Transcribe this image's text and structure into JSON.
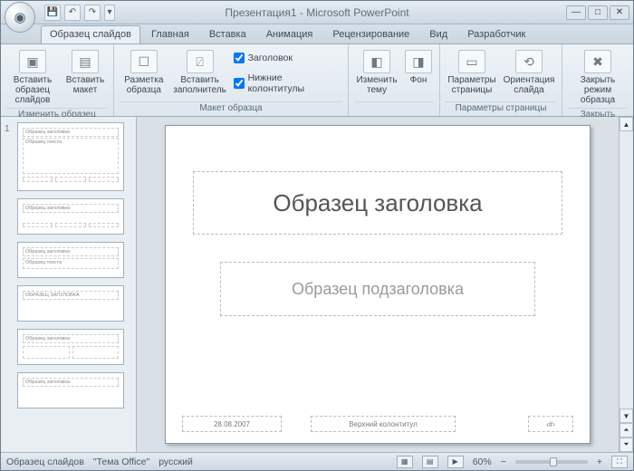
{
  "title": "Презентация1 - Microsoft PowerPoint",
  "qat": {
    "save": "💾",
    "undo": "↶",
    "redo": "↷",
    "more": "▾"
  },
  "tabs": {
    "master": "Образец слайдов",
    "home": "Главная",
    "insert": "Вставка",
    "anim": "Анимация",
    "review": "Рецензирование",
    "view": "Вид",
    "dev": "Разработчик"
  },
  "ribbon": {
    "g1": {
      "label": "Изменить образец",
      "insert_master": "Вставить образец слайдов",
      "insert_layout": "Вставить макет"
    },
    "g2": {
      "label": "Макет образца",
      "layout": "Разметка образца",
      "placeholder": "Вставить заполнитель",
      "chk_title": "Заголовок",
      "chk_footers": "Нижние колонтитулы"
    },
    "g3": {
      "themes": "Изменить тему",
      "bg": "Фон"
    },
    "g4": {
      "label": "Параметры страницы",
      "page_setup": "Параметры страницы",
      "orientation": "Ориентация слайда"
    },
    "g5": {
      "label": "Закрыть",
      "close": "Закрыть режим образца"
    }
  },
  "thumbs": {
    "num": "1",
    "master_title": "Образец заголовка",
    "layout_title": "Образец заголовка",
    "layout_uc": "ОБРАЗЕЦ ЗАГОЛОВКА",
    "text_small": "Образец текста"
  },
  "slide": {
    "title": "Образец заголовка",
    "subtitle": "Образец подзаголовка",
    "date": "28.08.2007",
    "footer": "Верхний колонтитул",
    "num": "‹#›"
  },
  "status": {
    "master": "Образец слайдов",
    "theme": "\"Тема Office\"",
    "lang": "русский",
    "zoom": "60%",
    "fit_tip": "⛶"
  }
}
